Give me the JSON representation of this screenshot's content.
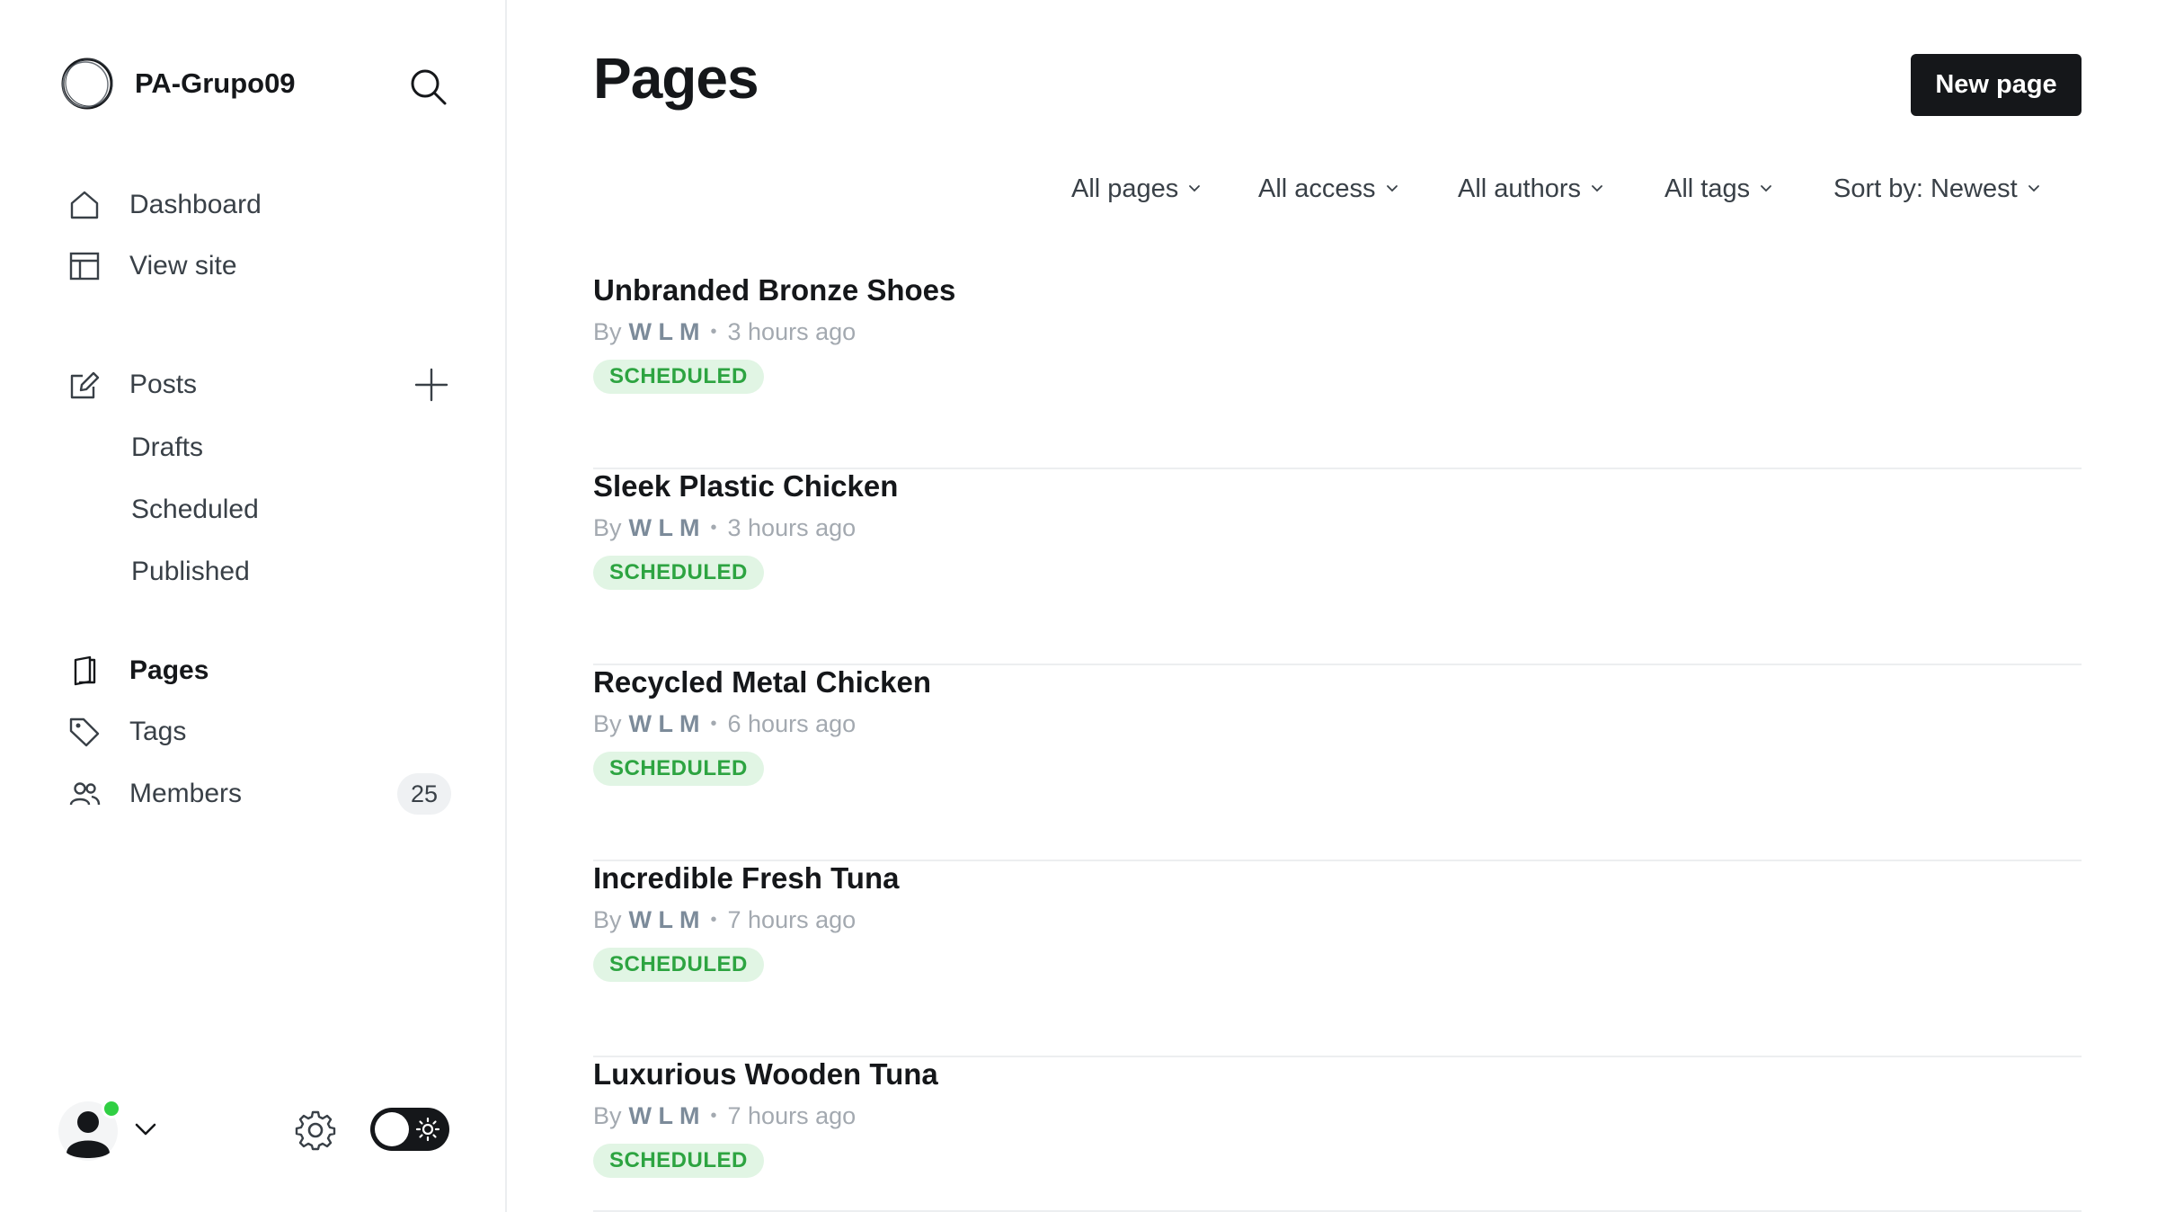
{
  "sidebar": {
    "site_name": "PA-Grupo09",
    "nav": {
      "dashboard": "Dashboard",
      "view_site": "View site",
      "posts": "Posts",
      "drafts": "Drafts",
      "scheduled": "Scheduled",
      "published": "Published",
      "pages": "Pages",
      "tags": "Tags",
      "members": "Members"
    },
    "members_count": "25",
    "active_item": "Pages"
  },
  "main": {
    "title": "Pages",
    "new_page_label": "New page",
    "filters": {
      "type": "All pages",
      "access": "All access",
      "authors": "All authors",
      "tags": "All tags",
      "sort": "Sort by: Newest"
    },
    "items": [
      {
        "title": "Unbranded Bronze Shoes",
        "by": "By",
        "author": "W L M",
        "time": "3 hours ago",
        "status": "SCHEDULED"
      },
      {
        "title": "Sleek Plastic Chicken",
        "by": "By",
        "author": "W L M",
        "time": "3 hours ago",
        "status": "SCHEDULED"
      },
      {
        "title": "Recycled Metal Chicken",
        "by": "By",
        "author": "W L M",
        "time": "6 hours ago",
        "status": "SCHEDULED"
      },
      {
        "title": "Incredible Fresh Tuna",
        "by": "By",
        "author": "W L M",
        "time": "7 hours ago",
        "status": "SCHEDULED"
      },
      {
        "title": "Luxurious Wooden Tuna",
        "by": "By",
        "author": "W L M",
        "time": "7 hours ago",
        "status": "SCHEDULED"
      }
    ]
  },
  "colors": {
    "text_primary": "#15171a",
    "accent_button": "#15171a",
    "scheduled_badge_bg": "#e1f5e4",
    "scheduled_badge_text": "#2da441",
    "online_dot": "#30cf43"
  },
  "icons": {
    "logo": "ring-logo-icon",
    "search": "search-icon",
    "dashboard": "home-icon",
    "view_site": "layout-icon",
    "posts": "pencil-square-icon",
    "add": "plus-icon",
    "pages": "page-icon",
    "tags": "tag-icon",
    "members": "users-icon",
    "settings": "gear-icon",
    "theme": "sun-icon"
  }
}
